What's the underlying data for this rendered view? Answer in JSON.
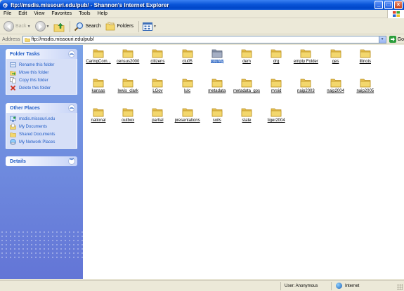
{
  "window": {
    "title": "ftp://msdis.missouri.edu/pub/ - Shannon's Internet Explorer",
    "controls": [
      "minimize-icon",
      "maximize-icon",
      "close-icon"
    ]
  },
  "menubar": {
    "items": [
      "File",
      "Edit",
      "View",
      "Favorites",
      "Tools",
      "Help"
    ]
  },
  "toolbar": {
    "back_label": "Back",
    "search_label": "Search",
    "folders_label": "Folders"
  },
  "address": {
    "label": "Address",
    "value": "ftp://msdis.missouri.edu/pub/",
    "go_label": "Go"
  },
  "sidebar": {
    "folder_tasks": {
      "title": "Folder Tasks",
      "items": [
        {
          "label": "Rename this folder",
          "icon": "rename-icon"
        },
        {
          "label": "Move this folder",
          "icon": "move-icon"
        },
        {
          "label": "Copy this folder",
          "icon": "copy-icon"
        },
        {
          "label": "Delete this folder",
          "icon": "delete-icon"
        }
      ]
    },
    "other_places": {
      "title": "Other Places",
      "items": [
        {
          "label": "msdis.missouri.edu",
          "icon": "ftp-site-icon"
        },
        {
          "label": "My Documents",
          "icon": "my-documents-icon"
        },
        {
          "label": "Shared Documents",
          "icon": "shared-documents-icon"
        },
        {
          "label": "My Network Places",
          "icon": "network-places-icon"
        }
      ]
    },
    "details": {
      "title": "Details"
    }
  },
  "folders": [
    "CaringCom...",
    "census2000",
    "citizens",
    "clu05",
    "county",
    "dem",
    "drg",
    "empty Folder",
    "ges",
    "illinois",
    "kansas",
    "lewis_clark",
    "LGov",
    "lulc",
    "metadata",
    "metadata_gos",
    "mrsid",
    "naip2003",
    "naip2004",
    "naip2005",
    "national",
    "outbox",
    "partial",
    "presentations",
    "soils",
    "state",
    "tiger2004"
  ],
  "selected_folder": "county",
  "statusbar": {
    "user": "User: Anonymous",
    "zone": "Internet"
  },
  "colors": {
    "titlebar": "#0a55d8",
    "sidebar_top": "#7ba2e7",
    "sidebar_bottom": "#6375d6",
    "link": "#215dc6",
    "selection": "#316ac5",
    "folder": "#f3d76d"
  }
}
